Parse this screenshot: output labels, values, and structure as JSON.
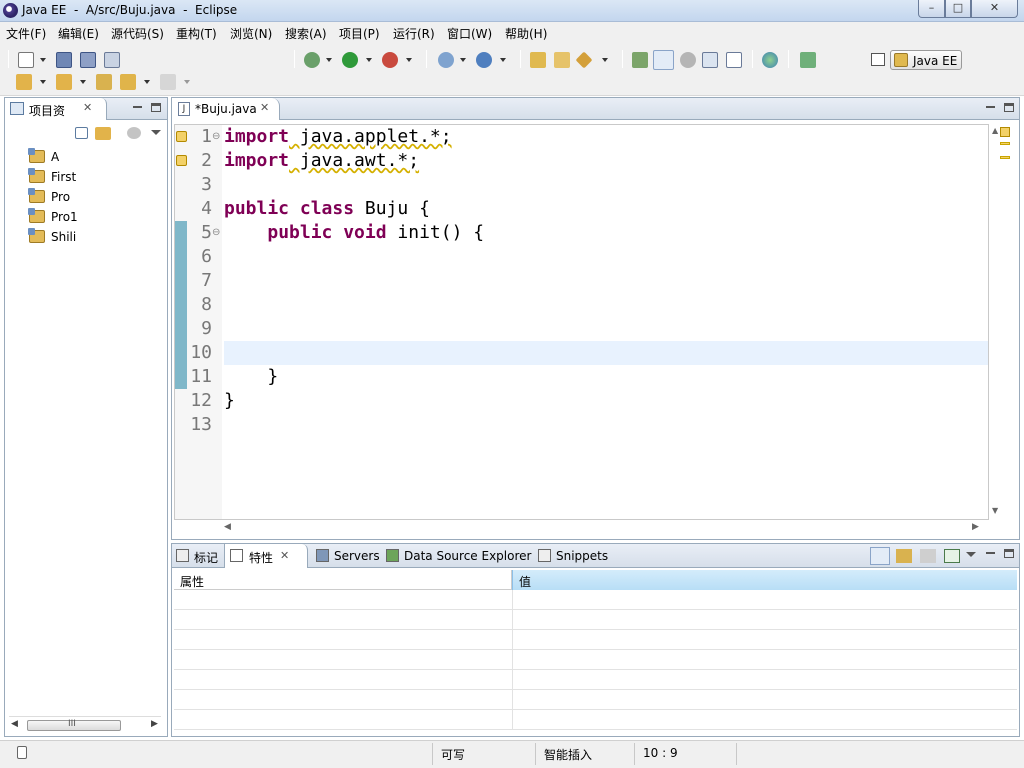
{
  "window": {
    "title": "Java EE  -  A/src/Buju.java  -  Eclipse",
    "controls": {
      "minimize": "–",
      "maximize": "□",
      "close": "✕"
    }
  },
  "menubar": {
    "items": [
      "文件(F)",
      "编辑(E)",
      "源代码(S)",
      "重构(T)",
      "浏览(N)",
      "搜索(A)",
      "项目(P)",
      "运行(R)",
      "窗口(W)",
      "帮助(H)"
    ]
  },
  "toolbar": {
    "perspective_label": "Java EE"
  },
  "project_explorer": {
    "tab_label": "项目资",
    "projects": [
      "A",
      "First",
      "Pro",
      "Pro1",
      "Shili"
    ],
    "scroll_label": "III"
  },
  "editor": {
    "tab_label": "*Buju.java",
    "line_numbers": [
      "1",
      "2",
      "3",
      "4",
      "5",
      "6",
      "7",
      "8",
      "9",
      "10",
      "11",
      "12",
      "13"
    ],
    "code": {
      "l1_kw": "import",
      "l1_rest": " java.applet.*;",
      "l2_kw": "import",
      "l2_rest": " java.awt.*;",
      "l4_kw": "public class",
      "l4_rest": " Buju {",
      "l5_kw": "public void",
      "l5_rest": " init() {",
      "l11": "    }",
      "l12": "}"
    }
  },
  "bottom_panel": {
    "tabs": [
      "标记",
      "特性",
      "Servers",
      "Data Source Explorer",
      "Snippets"
    ],
    "columns": [
      "属性",
      "值"
    ],
    "row_count": 7
  },
  "statusbar": {
    "mode_writable": "可写",
    "insert_mode": "智能插入",
    "cursor_position": "10 : 9"
  }
}
